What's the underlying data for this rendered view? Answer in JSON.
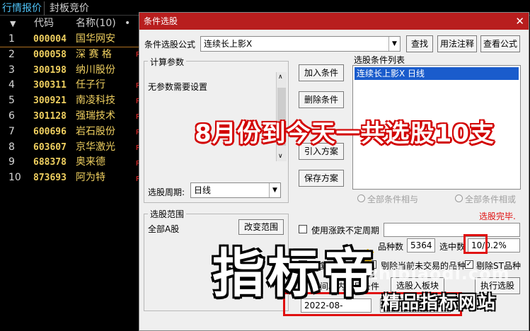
{
  "tabs": {
    "quotes": "行情报价",
    "auction": "封板竞价"
  },
  "list_header": {
    "sort_icon": "▼",
    "code": "代码",
    "name": "名称(10)",
    "dot": "•"
  },
  "stocks": [
    {
      "idx": "1",
      "code": "000004",
      "name": "国华网安"
    },
    {
      "idx": "2",
      "code": "000058",
      "name": "深 赛 格"
    },
    {
      "idx": "3",
      "code": "300198",
      "name": "纳川股份"
    },
    {
      "idx": "4",
      "code": "300311",
      "name": "任子行"
    },
    {
      "idx": "5",
      "code": "300921",
      "name": "南凌科技"
    },
    {
      "idx": "6",
      "code": "301128",
      "name": "强瑞技术"
    },
    {
      "idx": "7",
      "code": "600696",
      "name": "岩石股份"
    },
    {
      "idx": "8",
      "code": "603607",
      "name": "京华激光"
    },
    {
      "idx": "9",
      "code": "688378",
      "name": "奥来德"
    },
    {
      "idx": "10",
      "code": "873693",
      "name": "阿为特"
    }
  ],
  "right_edge": {
    "letter": "R"
  },
  "dialog": {
    "title": "条件选股",
    "close": "✕",
    "formula_label": "条件选股公式",
    "formula_value": "连续长上影X",
    "find": "查找",
    "usage": "用法注释",
    "view_formula": "查看公式",
    "params_title": "计算参数",
    "params_text": "无参数需要设置",
    "add_cond": "加入条件",
    "del_cond": "删除条件",
    "import_plan": "引入方案",
    "save_plan": "保存方案",
    "cond_list_title": "选股条件列表",
    "cond_item": "连续长上影X  日线",
    "period_label": "选股周期:",
    "period_value": "日线",
    "all_and": "全部条件相与",
    "all_or": "全部条件相或",
    "range_title": "选股范围",
    "range_value": "全部A股",
    "change_range": "改变范围",
    "status": "选股完毕.",
    "use_unfixed": "使用涨跌不定周期",
    "count_label": "品种数",
    "count_value": "5364",
    "selected_label": "选中数",
    "selected_value": "10/0.2%",
    "reweight": "前复权数据",
    "exclude_suspended": "剔除当前未交易的品种",
    "exclude_st": "剔除ST品种",
    "time_range": "时间段内满足条件",
    "to_block": "选股入板块",
    "run": "执行选股",
    "date_from": "2022-08-",
    "date_to": "2024-…21"
  },
  "overlay": {
    "banner": "8月份到今天一共选股10支",
    "watermark": "指标帝",
    "watermark_url": "zhibiaodi.com",
    "watermark_sub": "精品指标网站"
  },
  "colors": {
    "title_bar": "#b81e1e",
    "selection": "#1a5ccc",
    "highlight_box": "#e01010",
    "stock_text": "#f0d060"
  }
}
